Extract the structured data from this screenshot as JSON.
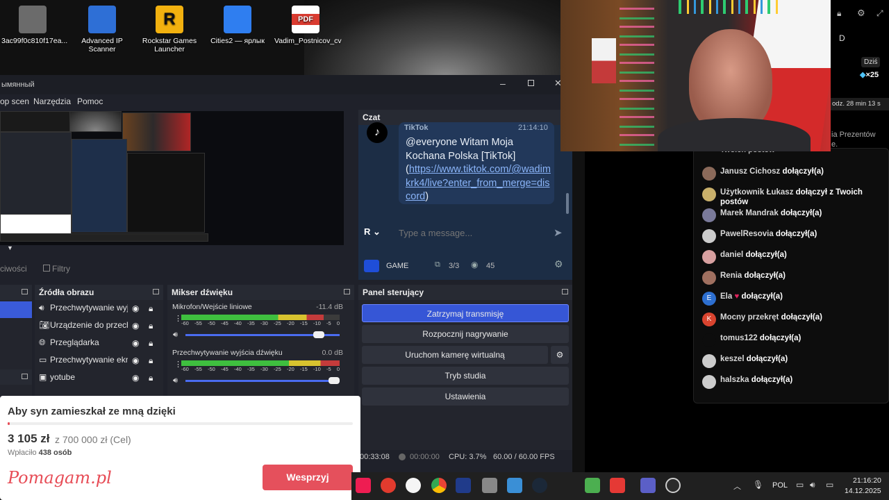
{
  "desktop": {
    "icons": [
      {
        "label": "3ac99f0c810f17ea...",
        "color": "#6b6b6b"
      },
      {
        "label": "Advanced IP Scanner",
        "color": "#2e6fd6"
      },
      {
        "label": "Rockstar Games Launcher",
        "color": "#f2b10f"
      },
      {
        "label": "Cities2 — ярлык",
        "color": "#2f7ef0"
      },
      {
        "label": "Vadim_Postnicov_cv",
        "color": "#d93b30"
      }
    ]
  },
  "obs": {
    "title": "ымянный",
    "menu": [
      "ор scen",
      "Narzędzia",
      "Pomoc"
    ],
    "tabs": {
      "properties": "ciwości",
      "filters": "Filtry"
    },
    "sources_title": "Źródła obrazu",
    "sources": [
      "Przechwytywanie wyjś",
      "Urządzenie do przech",
      "Przeglądarka",
      "Przechwytywanie ekra",
      "yotube"
    ],
    "mixer": {
      "title": "Mikser dźwięku",
      "channels": [
        {
          "name": "Mikrofon/Wejście liniowe",
          "db": "-11.4 dB",
          "level": 0.9
        },
        {
          "name": "Przechwytywanie wyjścia dźwięku",
          "db": "0.0 dB",
          "level": 1.0
        }
      ],
      "scale": [
        "-60",
        "-55",
        "-50",
        "-45",
        "-40",
        "-35",
        "-30",
        "-25",
        "-20",
        "-15",
        "-10",
        "-5",
        "0"
      ]
    },
    "controls": {
      "title": "Panel sterujący",
      "stop_stream": "Zatrzymaj transmisję",
      "record": "Rozpocznij nagrywanie",
      "virtual_cam": "Uruchom kamerę wirtualną",
      "studio": "Tryb studia",
      "settings": "Ustawienia"
    },
    "status": {
      "stream_time": "00:33:08",
      "rec_time": "00:00:00",
      "cpu": "CPU: 3.7%",
      "fps": "60.00 / 60.00 FPS"
    }
  },
  "chat_dock": {
    "title": "Czat",
    "source": "TikTok",
    "time": "21:14:10",
    "message_text": "@everyone Witam Moja Kochana Polska [TikTok]",
    "link_open": "(",
    "link": "https://www.tiktok.com/@wadimkrk4/live?enter_from_merge=discord",
    "link_close": ")",
    "placeholder": "Type a message...",
    "game_label": "GAME",
    "viewers_ratio": "3/3",
    "viewers": "45"
  },
  "right_panel": {
    "top_text": "D",
    "today": "Dziś",
    "multiplier": "×25",
    "timer": "odz. 28 min 13 s",
    "gift_text": "ia Prezentów",
    "gift_text2": "e.",
    "partial_header": "Twoich postów",
    "feed": [
      {
        "user": "Janusz Cichosz",
        "action": "dołączył(a)",
        "avatar": "#8b6a5a"
      },
      {
        "user": "Użytkownik Łukasz",
        "action": "dołączył z Twoich postów",
        "avatar": "#c9b06b"
      },
      {
        "user": "Marek Mandrak",
        "action": "dołączył(a)",
        "avatar": "#7a7a9a"
      },
      {
        "user": "PawelResovia",
        "action": "dołączył(a)",
        "avatar": "#cccccc"
      },
      {
        "user": "daniel",
        "action": "dołączył(a)",
        "avatar": "#d8a0a0"
      },
      {
        "user": "Renia",
        "action": "dołączył(a)",
        "avatar": "#a07060"
      },
      {
        "user": "Ela",
        "action": "dołączył(a)",
        "avatar": "#2d6fd0",
        "initial": "E",
        "heart": "♥"
      },
      {
        "user": "Mocny przekręt",
        "action": "dołączył(a)",
        "avatar": "#d9442f",
        "initial": "K"
      },
      {
        "user": "tomus122",
        "action": "dołączył(a)",
        "avatar": "#0d0d0d"
      },
      {
        "user": "keszel",
        "action": "dołączył(a)",
        "avatar": "#cccccc"
      },
      {
        "user": "halszka",
        "action": "dołączył(a)",
        "avatar": "#cccccc"
      }
    ]
  },
  "donation": {
    "title": "Aby syn zamieszkał ze mną dzięki",
    "amount": "3 105 zł",
    "goal": "z 700 000 zł (Cel)",
    "paid_label": "Wpłaciło",
    "paid_count": "438 osób",
    "logo": "Pomagam.pl",
    "button": "Wesprzyj",
    "progress": 0.0044
  },
  "taskbar": {
    "lang": "POL",
    "time": "21:16:20",
    "date": "14.12.2025"
  }
}
